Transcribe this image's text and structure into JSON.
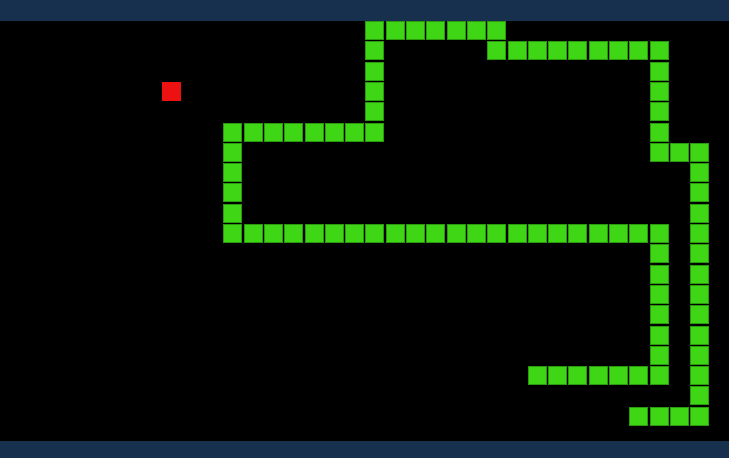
{
  "colors": {
    "bar": "#17304d",
    "board": "#000000",
    "snake": "#3fd616",
    "snake_border": "#2b9a0e",
    "food": "#ee1111"
  },
  "grid": {
    "cols": 36,
    "rows": 21
  },
  "food": [
    8,
    3
  ],
  "snake": [
    [
      18,
      0
    ],
    [
      19,
      0
    ],
    [
      20,
      0
    ],
    [
      21,
      0
    ],
    [
      22,
      0
    ],
    [
      23,
      0
    ],
    [
      24,
      0
    ],
    [
      24,
      1
    ],
    [
      25,
      1
    ],
    [
      26,
      1
    ],
    [
      27,
      1
    ],
    [
      28,
      1
    ],
    [
      29,
      1
    ],
    [
      30,
      1
    ],
    [
      31,
      1
    ],
    [
      32,
      1
    ],
    [
      32,
      2
    ],
    [
      32,
      3
    ],
    [
      32,
      4
    ],
    [
      32,
      5
    ],
    [
      32,
      6
    ],
    [
      33,
      6
    ],
    [
      34,
      6
    ],
    [
      34,
      7
    ],
    [
      34,
      8
    ],
    [
      34,
      9
    ],
    [
      34,
      10
    ],
    [
      34,
      11
    ],
    [
      34,
      12
    ],
    [
      34,
      13
    ],
    [
      34,
      14
    ],
    [
      34,
      15
    ],
    [
      34,
      16
    ],
    [
      34,
      17
    ],
    [
      34,
      18
    ],
    [
      34,
      19
    ],
    [
      33,
      19
    ],
    [
      32,
      19
    ],
    [
      31,
      19
    ],
    [
      18,
      1
    ],
    [
      18,
      2
    ],
    [
      18,
      3
    ],
    [
      18,
      4
    ],
    [
      18,
      5
    ],
    [
      17,
      5
    ],
    [
      16,
      5
    ],
    [
      15,
      5
    ],
    [
      14,
      5
    ],
    [
      13,
      5
    ],
    [
      12,
      5
    ],
    [
      11,
      5
    ],
    [
      11,
      6
    ],
    [
      11,
      7
    ],
    [
      11,
      8
    ],
    [
      11,
      9
    ],
    [
      11,
      10
    ],
    [
      12,
      10
    ],
    [
      13,
      10
    ],
    [
      14,
      10
    ],
    [
      15,
      10
    ],
    [
      16,
      10
    ],
    [
      17,
      10
    ],
    [
      18,
      10
    ],
    [
      19,
      10
    ],
    [
      20,
      10
    ],
    [
      21,
      10
    ],
    [
      22,
      10
    ],
    [
      23,
      10
    ],
    [
      24,
      10
    ],
    [
      25,
      10
    ],
    [
      26,
      10
    ],
    [
      27,
      10
    ],
    [
      28,
      10
    ],
    [
      29,
      10
    ],
    [
      30,
      10
    ],
    [
      31,
      10
    ],
    [
      32,
      10
    ],
    [
      32,
      11
    ],
    [
      32,
      12
    ],
    [
      32,
      13
    ],
    [
      32,
      14
    ],
    [
      32,
      15
    ],
    [
      32,
      16
    ],
    [
      32,
      17
    ],
    [
      31,
      17
    ],
    [
      30,
      17
    ],
    [
      29,
      17
    ],
    [
      28,
      17
    ],
    [
      27,
      17
    ],
    [
      26,
      17
    ]
  ]
}
